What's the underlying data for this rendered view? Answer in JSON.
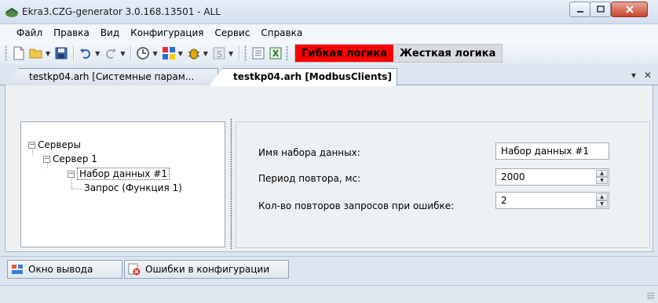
{
  "window": {
    "title": "Ekra3.CZG-generator 3.0.168.13501 - ALL"
  },
  "menu": [
    "Файл",
    "Правка",
    "Вид",
    "Конфигурация",
    "Сервис",
    "Справка"
  ],
  "toolbar": {
    "mode_flex": "Гибкая логика",
    "mode_hard": "Жесткая логика",
    "mode_flex_color": "#ff0000"
  },
  "doc_tabs": [
    {
      "label": "testkp04.arh [Системные парам...",
      "active": false
    },
    {
      "label": "testkp04.arh [ModbusClients]",
      "active": true
    }
  ],
  "tab_controls": {
    "dropdown": "▾",
    "close": "✕"
  },
  "tree": {
    "root": "Серверы",
    "server": "Сервер 1",
    "dataset": "Набор данных #1",
    "request": "Запрос (Функция 1)"
  },
  "properties": {
    "dataset_name_label": "Имя набора данных:",
    "dataset_name_value": "Набор данных #1",
    "period_label": "Период повтора, мс:",
    "period_value": "2000",
    "retries_label": "Кол-во повторов запросов при ошибке:",
    "retries_value": "2"
  },
  "bottom_tabs": [
    "Окно вывода",
    "Ошибки в конфигурации"
  ]
}
